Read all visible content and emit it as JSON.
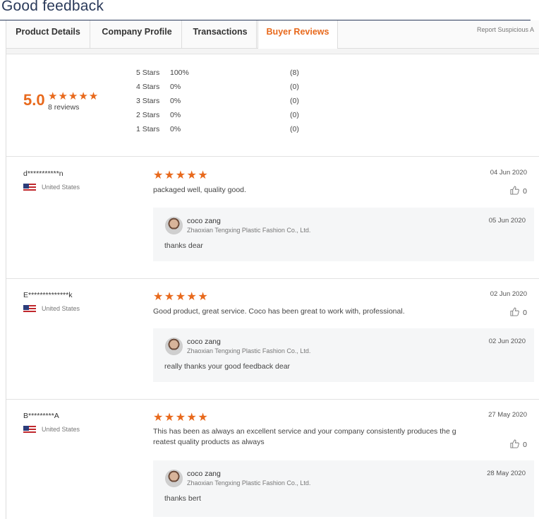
{
  "page_title": "Good feedback",
  "tabs": [
    {
      "label": "Product Details"
    },
    {
      "label": "Company Profile"
    },
    {
      "label": "Transactions"
    },
    {
      "label": "Buyer Reviews"
    }
  ],
  "report_link": "Report Suspicious A",
  "summary": {
    "score": "5.0",
    "stars": "★★★★★",
    "review_count": "8 reviews",
    "distribution": [
      {
        "label": "5 Stars",
        "pct": "100%",
        "count": "(8)"
      },
      {
        "label": "4 Stars",
        "pct": "0%",
        "count": "(0)"
      },
      {
        "label": "3 Stars",
        "pct": "0%",
        "count": "(0)"
      },
      {
        "label": "2 Stars",
        "pct": "0%",
        "count": "(0)"
      },
      {
        "label": "1 Stars",
        "pct": "0%",
        "count": "(0)"
      }
    ]
  },
  "reviews": [
    {
      "reviewer": "d***********n",
      "country": "United States",
      "stars": "★★★★★",
      "date": "04 Jun 2020",
      "text": "packaged well, quality good.",
      "likes": "0",
      "reply": {
        "seller": "coco zang",
        "company": "Zhaoxian Tengxing Plastic Fashion Co., Ltd.",
        "date": "05 Jun 2020",
        "text": "thanks dear"
      }
    },
    {
      "reviewer": "E**************k",
      "country": "United States",
      "stars": "★★★★★",
      "date": "02 Jun 2020",
      "text": "Good product, great service.  Coco has been great to work with, professional.",
      "likes": "0",
      "reply": {
        "seller": "coco zang",
        "company": "Zhaoxian Tengxing Plastic Fashion Co., Ltd.",
        "date": "02 Jun 2020",
        "text": "really thanks your good feedback dear"
      }
    },
    {
      "reviewer": "B*********A",
      "country": "United States",
      "stars": "★★★★★",
      "date": "27 May 2020",
      "text": "This has been as always an excellent service and your company consistently produces the g reatest quality products as always",
      "likes": "0",
      "reply": {
        "seller": "coco zang",
        "company": "Zhaoxian Tengxing Plastic Fashion Co., Ltd.",
        "date": "28 May 2020",
        "text": "thanks bert"
      }
    }
  ]
}
